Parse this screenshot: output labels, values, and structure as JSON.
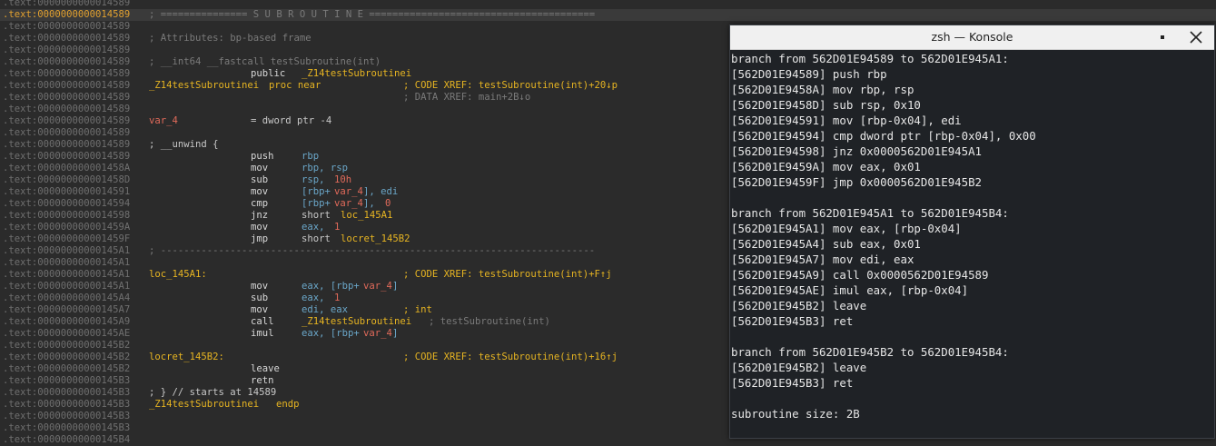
{
  "listing": {
    "lines": [
      {
        "addr": ".text:0000000000014589",
        "hl": false,
        "segs": []
      },
      {
        "addr": ".text:0000000000014589",
        "hl": true,
        "segs": [
          {
            "t": "; =============== S U B R O U T I N E =======================================",
            "c": "c-cmt",
            "col": 164
          }
        ]
      },
      {
        "addr": ".text:0000000000014589",
        "hl": false,
        "segs": []
      },
      {
        "addr": ".text:0000000000014589",
        "hl": false,
        "segs": [
          {
            "t": "; Attributes: bp-based frame",
            "c": "c-cmt",
            "col": 164
          }
        ]
      },
      {
        "addr": ".text:0000000000014589",
        "hl": false,
        "segs": []
      },
      {
        "addr": ".text:0000000000014589",
        "hl": false,
        "segs": [
          {
            "t": "; __int64 __fastcall testSubroutine(int)",
            "c": "c-cmt",
            "col": 164
          }
        ]
      },
      {
        "addr": ".text:0000000000014589",
        "hl": false,
        "segs": [
          {
            "t": "public",
            "c": "c-mnem",
            "col": 276
          },
          {
            "t": "_Z14testSubroutinei",
            "c": "c-yellow",
            "col": 332
          }
        ]
      },
      {
        "addr": ".text:0000000000014589",
        "hl": false,
        "segs": [
          {
            "t": "_Z14testSubroutinei",
            "c": "c-label",
            "col": 164
          },
          {
            "t": "proc near",
            "c": "c-yellow",
            "col": 296
          },
          {
            "t": "; CODE XREF: testSubroutine(int)+20↓p",
            "c": "c-yellow",
            "col": 444
          }
        ]
      },
      {
        "addr": ".text:0000000000014589",
        "hl": false,
        "segs": [
          {
            "t": "; DATA XREF: main+2B↓o",
            "c": "c-cmt",
            "col": 444
          }
        ]
      },
      {
        "addr": ".text:0000000000014589",
        "hl": false,
        "segs": []
      },
      {
        "addr": ".text:0000000000014589",
        "hl": false,
        "segs": [
          {
            "t": "var_4",
            "c": "c-var",
            "col": 164
          },
          {
            "t": "= dword ptr -4",
            "c": "c-plain",
            "col": 276
          }
        ]
      },
      {
        "addr": ".text:0000000000014589",
        "hl": false,
        "segs": []
      },
      {
        "addr": ".text:0000000000014589",
        "hl": false,
        "segs": [
          {
            "t": "; __unwind {",
            "c": "c-plain",
            "col": 164
          }
        ]
      },
      {
        "addr": ".text:0000000000014589",
        "hl": false,
        "segs": [
          {
            "t": "push",
            "c": "c-mnem",
            "col": 276
          },
          {
            "t": "rbp",
            "c": "c-reg",
            "col": 332
          }
        ]
      },
      {
        "addr": ".text:000000000001458A",
        "hl": false,
        "segs": [
          {
            "t": "mov",
            "c": "c-mnem",
            "col": 276
          },
          {
            "t": "rbp, rsp",
            "c": "c-reg",
            "col": 332
          }
        ]
      },
      {
        "addr": ".text:000000000001458D",
        "hl": false,
        "segs": [
          {
            "t": "sub",
            "c": "c-mnem",
            "col": 276
          },
          {
            "t": "rsp, ",
            "c": "c-reg",
            "col": 332
          },
          {
            "t": "10h",
            "c": "c-num",
            "col": 368
          }
        ]
      },
      {
        "addr": ".text:0000000000014591",
        "hl": false,
        "segs": [
          {
            "t": "mov",
            "c": "c-mnem",
            "col": 276
          },
          {
            "t": "[rbp+",
            "c": "c-reg",
            "col": 332
          },
          {
            "t": "var_4",
            "c": "c-var",
            "col": 368
          },
          {
            "t": "], edi",
            "c": "c-reg",
            "col": 400
          }
        ]
      },
      {
        "addr": ".text:0000000000014594",
        "hl": false,
        "segs": [
          {
            "t": "cmp",
            "c": "c-mnem",
            "col": 276
          },
          {
            "t": "[rbp+",
            "c": "c-reg",
            "col": 332
          },
          {
            "t": "var_4",
            "c": "c-var",
            "col": 368
          },
          {
            "t": "], ",
            "c": "c-reg",
            "col": 400
          },
          {
            "t": "0",
            "c": "c-num",
            "col": 424
          }
        ]
      },
      {
        "addr": ".text:0000000000014598",
        "hl": false,
        "segs": [
          {
            "t": "jnz",
            "c": "c-mnem",
            "col": 276
          },
          {
            "t": "short",
            "c": "c-plain",
            "col": 332
          },
          {
            "t": "loc_145A1",
            "c": "c-yellow",
            "col": 375
          }
        ]
      },
      {
        "addr": ".text:000000000001459A",
        "hl": false,
        "segs": [
          {
            "t": "mov",
            "c": "c-mnem",
            "col": 276
          },
          {
            "t": "eax, ",
            "c": "c-reg",
            "col": 332
          },
          {
            "t": "1",
            "c": "c-num",
            "col": 368
          }
        ]
      },
      {
        "addr": ".text:000000000001459F",
        "hl": false,
        "segs": [
          {
            "t": "jmp",
            "c": "c-mnem",
            "col": 276
          },
          {
            "t": "short",
            "c": "c-plain",
            "col": 332
          },
          {
            "t": "locret_145B2",
            "c": "c-yellow",
            "col": 375
          }
        ]
      },
      {
        "addr": ".text:00000000000145A1",
        "hl": false,
        "segs": [
          {
            "t": "; ---------------------------------------------------------------------------",
            "c": "c-cmt",
            "col": 164
          }
        ]
      },
      {
        "addr": ".text:00000000000145A1",
        "hl": false,
        "segs": []
      },
      {
        "addr": ".text:00000000000145A1",
        "hl": false,
        "segs": [
          {
            "t": "loc_145A1:",
            "c": "c-label",
            "col": 164
          },
          {
            "t": "; CODE XREF: testSubroutine(int)+F↑j",
            "c": "c-yellow",
            "col": 444
          }
        ]
      },
      {
        "addr": ".text:00000000000145A1",
        "hl": false,
        "segs": [
          {
            "t": "mov",
            "c": "c-mnem",
            "col": 276
          },
          {
            "t": "eax, [rbp+",
            "c": "c-reg",
            "col": 332
          },
          {
            "t": "var_4",
            "c": "c-var",
            "col": 400
          },
          {
            "t": "]",
            "c": "c-reg",
            "col": 432
          }
        ]
      },
      {
        "addr": ".text:00000000000145A4",
        "hl": false,
        "segs": [
          {
            "t": "sub",
            "c": "c-mnem",
            "col": 276
          },
          {
            "t": "eax, ",
            "c": "c-reg",
            "col": 332
          },
          {
            "t": "1",
            "c": "c-num",
            "col": 368
          }
        ]
      },
      {
        "addr": ".text:00000000000145A7",
        "hl": false,
        "segs": [
          {
            "t": "mov",
            "c": "c-mnem",
            "col": 276
          },
          {
            "t": "edi, eax",
            "c": "c-reg",
            "col": 332
          },
          {
            "t": "; int",
            "c": "c-yellow",
            "col": 444
          }
        ]
      },
      {
        "addr": ".text:00000000000145A9",
        "hl": false,
        "segs": [
          {
            "t": "call",
            "c": "c-mnem",
            "col": 276
          },
          {
            "t": "_Z14testSubroutinei",
            "c": "c-yellow",
            "col": 332
          },
          {
            "t": "; testSubroutine(int)",
            "c": "c-cmt",
            "col": 472
          }
        ]
      },
      {
        "addr": ".text:00000000000145AE",
        "hl": false,
        "segs": [
          {
            "t": "imul",
            "c": "c-mnem",
            "col": 276
          },
          {
            "t": "eax, [rbp+",
            "c": "c-reg",
            "col": 332
          },
          {
            "t": "var_4",
            "c": "c-var",
            "col": 400
          },
          {
            "t": "]",
            "c": "c-reg",
            "col": 432
          }
        ]
      },
      {
        "addr": ".text:00000000000145B2",
        "hl": false,
        "segs": []
      },
      {
        "addr": ".text:00000000000145B2",
        "hl": false,
        "segs": [
          {
            "t": "locret_145B2:",
            "c": "c-label",
            "col": 164
          },
          {
            "t": "; CODE XREF: testSubroutine(int)+16↑j",
            "c": "c-yellow",
            "col": 444
          }
        ]
      },
      {
        "addr": ".text:00000000000145B2",
        "hl": false,
        "segs": [
          {
            "t": "leave",
            "c": "c-mnem",
            "col": 276
          }
        ]
      },
      {
        "addr": ".text:00000000000145B3",
        "hl": false,
        "segs": [
          {
            "t": "retn",
            "c": "c-mnem",
            "col": 276
          }
        ]
      },
      {
        "addr": ".text:00000000000145B3",
        "hl": false,
        "segs": [
          {
            "t": "; } // starts at 14589",
            "c": "c-plain",
            "col": 164
          }
        ]
      },
      {
        "addr": ".text:00000000000145B3",
        "hl": false,
        "segs": [
          {
            "t": "_Z14testSubroutinei",
            "c": "c-label",
            "col": 164
          },
          {
            "t": "endp",
            "c": "c-yellow",
            "col": 304
          }
        ]
      },
      {
        "addr": ".text:00000000000145B3",
        "hl": false,
        "segs": []
      },
      {
        "addr": ".text:00000000000145B3",
        "hl": false,
        "segs": []
      },
      {
        "addr": ".text:00000000000145B4",
        "hl": false,
        "segs": []
      }
    ]
  },
  "konsole": {
    "title": "zsh — Konsole",
    "lines": [
      "branch from 562D01E94589 to 562D01E945A1:",
      "[562D01E94589] push rbp",
      "[562D01E9458A] mov rbp, rsp",
      "[562D01E9458D] sub rsp, 0x10",
      "[562D01E94591] mov [rbp-0x04], edi",
      "[562D01E94594] cmp dword ptr [rbp-0x04], 0x00",
      "[562D01E94598] jnz 0x0000562D01E945A1",
      "[562D01E9459A] mov eax, 0x01",
      "[562D01E9459F] jmp 0x0000562D01E945B2",
      "",
      "branch from 562D01E945A1 to 562D01E945B4:",
      "[562D01E945A1] mov eax, [rbp-0x04]",
      "[562D01E945A4] sub eax, 0x01",
      "[562D01E945A7] mov edi, eax",
      "[562D01E945A9] call 0x0000562D01E94589",
      "[562D01E945AE] imul eax, [rbp-0x04]",
      "[562D01E945B2] leave",
      "[562D01E945B3] ret",
      "",
      "branch from 562D01E945B2 to 562D01E945B4:",
      "[562D01E945B2] leave",
      "[562D01E945B3] ret",
      "",
      "subroutine size: 2B"
    ]
  }
}
